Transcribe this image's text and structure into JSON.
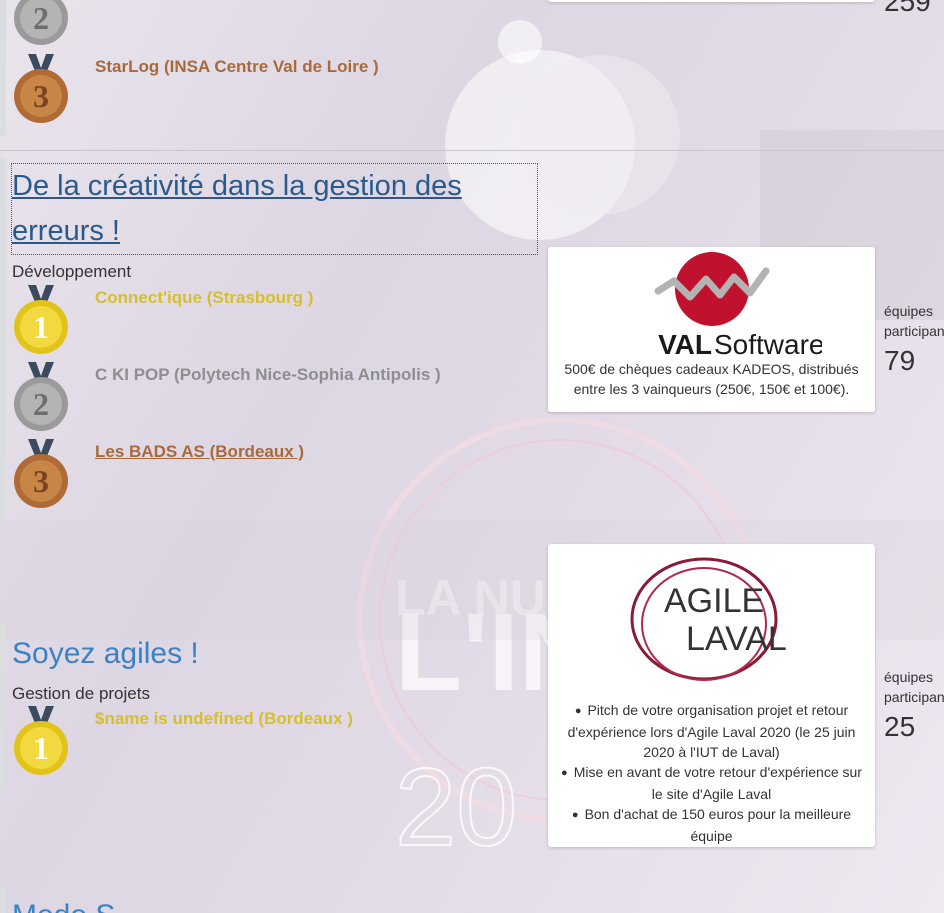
{
  "top_section": {
    "teams_count": "259",
    "winners": [
      {
        "rank": "2",
        "name": ""
      },
      {
        "rank": "3",
        "name": "StarLog (INSA Centre Val de Loire )"
      }
    ]
  },
  "challenge_errors": {
    "title": "De la créativité dans la gestion des erreurs !",
    "category": "Développement",
    "winners": [
      {
        "rank": "1",
        "name": "Connect'ique (Strasbourg )"
      },
      {
        "rank": "2",
        "name": "C KI POP (Polytech Nice-Sophia Antipolis )"
      },
      {
        "rank": "3",
        "name": "Les BADS AS (Bordeaux )"
      }
    ],
    "sponsor_logo": {
      "word1": "VAL",
      "word2": "Software"
    },
    "prize": "500€ de chèques cadeaux KADEOS, distribués entre les 3 vainqueurs (250€, 150€ et 100€).",
    "teams_label": "équipes participantes",
    "teams_count": "79"
  },
  "challenge_agile": {
    "title": "Soyez agiles !",
    "category": "Gestion de projets",
    "winners": [
      {
        "rank": "1",
        "name": "$name is undefined (Bordeaux )"
      }
    ],
    "sponsor_logo": {
      "word1": "AGILE",
      "word2": "LAVAL"
    },
    "prizes": [
      "Pitch de votre organisation projet et retour d'expérience lors d'Agile Laval 2020 (le 25 juin 2020 à l'IUT de Laval)",
      "Mise en avant de votre retour d'expérience sur le site d'Agile Laval",
      "Bon d'achat de 150 euros pour la meilleure équipe"
    ],
    "teams_label": "équipes participantes",
    "teams_count": "25"
  },
  "next_section": {
    "title_partial": "Mode S"
  },
  "colors": {
    "gold": "#d6bf2e",
    "silver": "#8e8e8e",
    "bronze": "#a86a3a",
    "link": "#2a5a8c",
    "title": "#3b82c4"
  }
}
